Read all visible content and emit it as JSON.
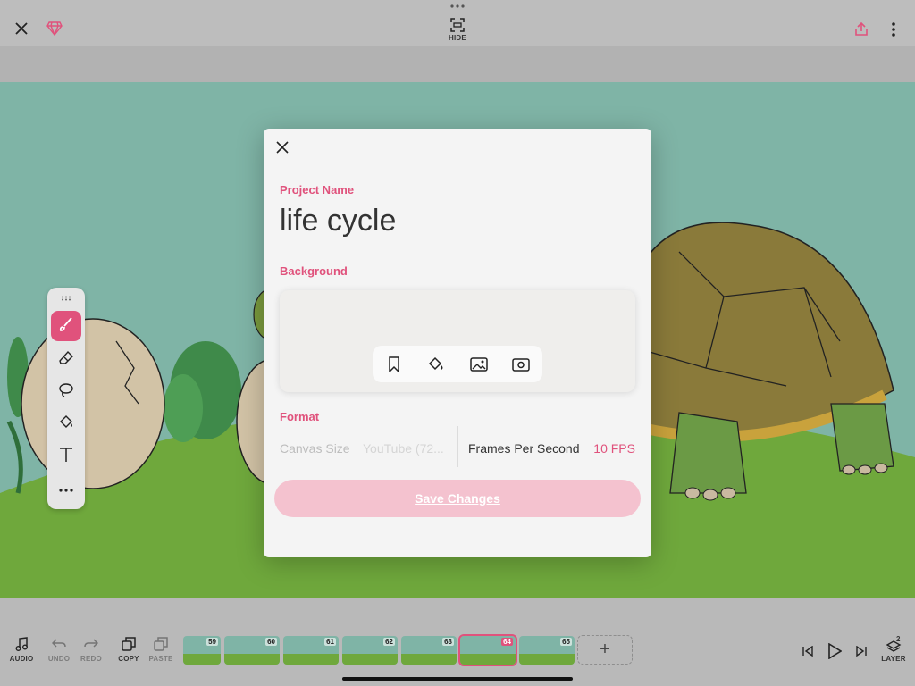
{
  "topbar": {
    "hide_label": "HIDE"
  },
  "modal": {
    "project_name_label": "Project Name",
    "project_name": "life cycle",
    "background_label": "Background",
    "background_tools": [
      "bookmark-icon",
      "paint-bucket-icon",
      "image-icon",
      "camera-icon"
    ],
    "format_label": "Format",
    "canvas_size_label": "Canvas Size",
    "canvas_size_value": "YouTube (72...",
    "fps_label": "Frames Per Second",
    "fps_value": "10 FPS",
    "save_label": "Save Changes"
  },
  "palette": {
    "tools": [
      "brush-icon",
      "eraser-icon",
      "lasso-icon",
      "fill-icon",
      "text-icon",
      "more-icon"
    ]
  },
  "bottombar": {
    "audio_label": "AUDIO",
    "undo_label": "UNDO",
    "redo_label": "REDO",
    "copy_label": "COPY",
    "paste_label": "PASTE",
    "layer_label": "LAYER",
    "layer_count": "2",
    "frames": [
      {
        "num": "59",
        "active": false
      },
      {
        "num": "60",
        "active": false
      },
      {
        "num": "61",
        "active": false
      },
      {
        "num": "62",
        "active": false
      },
      {
        "num": "63",
        "active": false
      },
      {
        "num": "64",
        "active": true
      },
      {
        "num": "65",
        "active": false
      }
    ],
    "add_frame": "+"
  },
  "colors": {
    "accent": "#e0527c",
    "sky": "#7fb4a6",
    "grass": "#6fa83c"
  }
}
